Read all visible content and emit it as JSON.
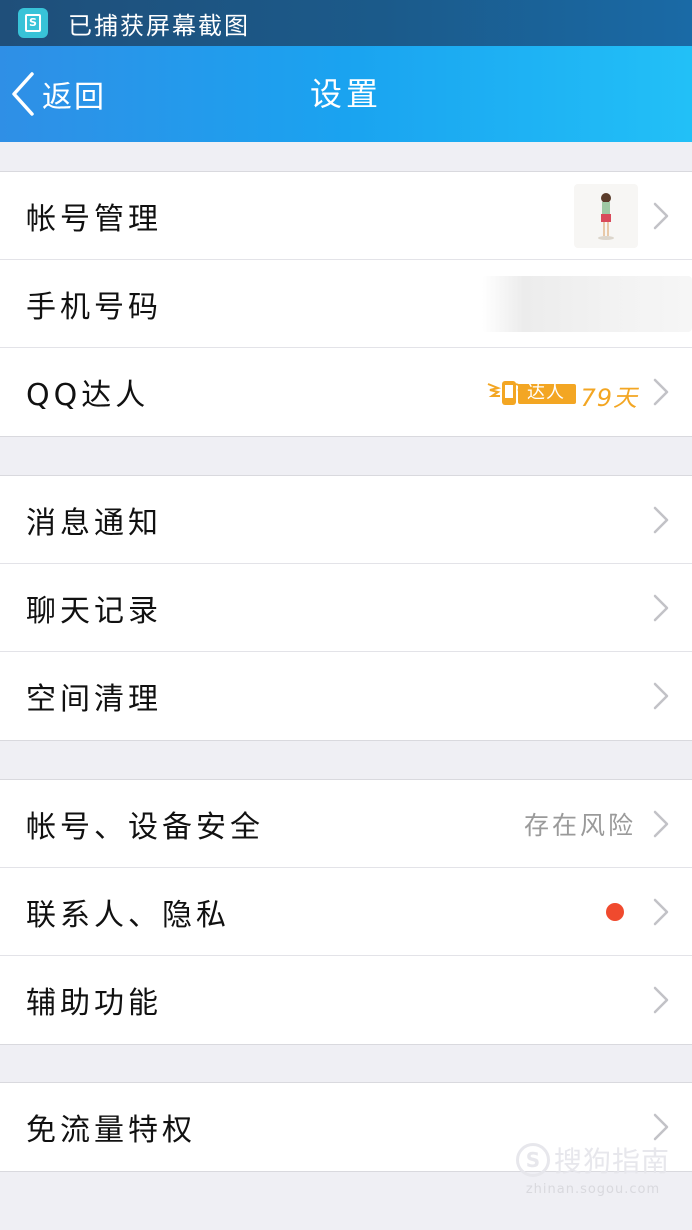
{
  "status_bar": {
    "app_icon": "screenshot-app-icon",
    "text": "已捕获屏幕截图"
  },
  "nav": {
    "back_label": "返回",
    "title": "设置",
    "gradient_start": "#2f8fe6",
    "gradient_end": "#22c0f7"
  },
  "groups": [
    {
      "rows": [
        {
          "label": "帐号管理"
        },
        {
          "label": "手机号码"
        },
        {
          "label": "QQ达人",
          "badge": "达人",
          "days": "79天"
        }
      ]
    },
    {
      "rows": [
        {
          "label": "消息通知"
        },
        {
          "label": "聊天记录"
        },
        {
          "label": "空间清理"
        }
      ]
    },
    {
      "rows": [
        {
          "label": "帐号、设备安全",
          "value": "存在风险"
        },
        {
          "label": "联系人、隐私",
          "indicator_color": "#f04a2e"
        },
        {
          "label": "辅助功能"
        }
      ]
    },
    {
      "rows": [
        {
          "label": "免流量特权"
        }
      ]
    }
  ],
  "watermark": {
    "logo_letter": "S",
    "text": "搜狗指南",
    "url": "zhinan.sogou.com"
  },
  "colors": {
    "background": "#efeff4",
    "badge_orange": "#f3a623",
    "red_dot": "#f04a2e"
  }
}
